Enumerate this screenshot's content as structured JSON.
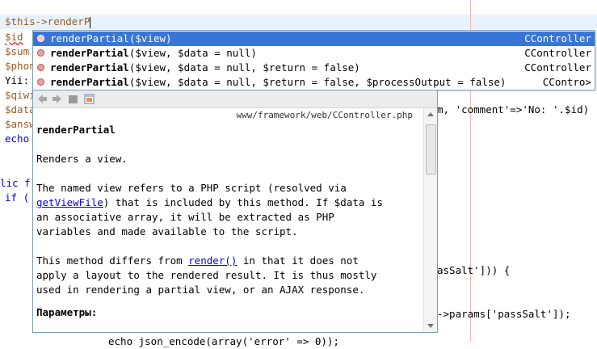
{
  "editor": {
    "input_line": "$this->renderP",
    "lines": [
      {
        "text": "$id"
      },
      {
        "text": "$sum"
      },
      {
        "text": "$phon"
      },
      {
        "text": "Yii:"
      },
      {
        "text": "$qiwi"
      },
      {
        "text": "$data"
      },
      {
        "text": "$answ"
      },
      {
        "text": "echo"
      },
      {
        "text": "lic f"
      },
      {
        "text": "if ("
      }
    ],
    "line9_right": "m, 'comment'=>'No: '.$id)",
    "line9_str1": "'comment'",
    "line9_str2": "'No: '",
    "line_passalt1": "asSalt'])) {",
    "line_passalt2": "->params['passSalt']);",
    "line_bottom": "echo json_encode(array('error' => 0));"
  },
  "completion": {
    "items": [
      {
        "name": "renderPartial",
        "params": "($view)",
        "class": "CController"
      },
      {
        "name": "renderPartial",
        "params": "($view, $data = null)",
        "class": "CController"
      },
      {
        "name": "renderPartial",
        "params": "($view, $data = null, $return = false)",
        "class": "CController"
      },
      {
        "name": "renderPartial",
        "params": "($view, $data = null, $return = false, $processOutput = false)",
        "class": "CContro>"
      }
    ]
  },
  "doc": {
    "path": "www/framework/web/CController.php",
    "title": "renderPartial",
    "summary": "Renders a view.",
    "p1_a": "The named view refers to a PHP script (resolved via",
    "p1_link": "getViewFile",
    "p1_b": ") that is included by this method. If $data is",
    "p1_c": "an associative array, it will be extracted as PHP",
    "p1_d": "variables and made available to the script.",
    "p2_a": "This method differs from ",
    "p2_link": "render()",
    "p2_b": " in that it does not",
    "p2_c": "apply a layout to the rendered result. It is thus mostly",
    "p2_d": "used in rendering a partial view, or an AJAX response.",
    "params_heading": "Параметры:"
  },
  "colors": {
    "selection": "#3875d7",
    "variable": "#9a5c26",
    "string": "#cc0000",
    "link": "#0000ee"
  },
  "icons": [
    "back-icon",
    "forward-icon",
    "source-icon",
    "open-in-browser-icon",
    "method-icon"
  ]
}
